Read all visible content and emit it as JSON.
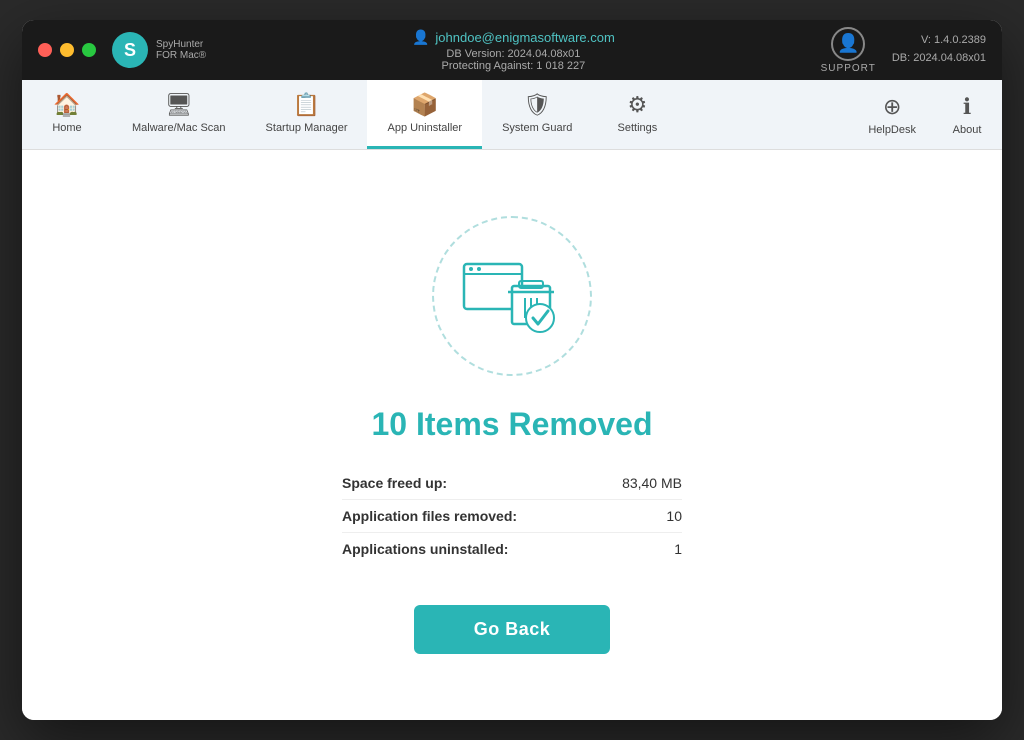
{
  "titlebar": {
    "logo_text": "SpyHunter",
    "logo_subtext": "FOR Mac®",
    "user_email": "johndoe@enigmasoftware.com",
    "db_version_label": "DB Version: 2024.04.08x01",
    "protecting_label": "Protecting Against: 1 018 227",
    "support_label": "SUPPORT",
    "version_line1": "V: 1.4.0.2389",
    "version_line2": "DB:  2024.04.08x01"
  },
  "navbar": {
    "items": [
      {
        "id": "home",
        "label": "Home",
        "icon": "🏠",
        "active": false
      },
      {
        "id": "malware-scan",
        "label": "Malware/Mac Scan",
        "icon": "🔍",
        "active": false
      },
      {
        "id": "startup-manager",
        "label": "Startup Manager",
        "icon": "⚙",
        "active": false
      },
      {
        "id": "app-uninstaller",
        "label": "App Uninstaller",
        "icon": "🗑",
        "active": true
      },
      {
        "id": "system-guard",
        "label": "System Guard",
        "icon": "🛡",
        "active": false
      },
      {
        "id": "settings",
        "label": "Settings",
        "icon": "⚙",
        "active": false
      }
    ],
    "right_items": [
      {
        "id": "helpdesk",
        "label": "HelpDesk",
        "icon": "➕"
      },
      {
        "id": "about",
        "label": "About",
        "icon": "ℹ"
      }
    ]
  },
  "main": {
    "result_title": "10 Items Removed",
    "stats": [
      {
        "label": "Space freed up:",
        "value": "83,40 MB"
      },
      {
        "label": "Application files removed:",
        "value": "10"
      },
      {
        "label": "Applications uninstalled:",
        "value": "1"
      }
    ],
    "go_back_label": "Go Back"
  }
}
